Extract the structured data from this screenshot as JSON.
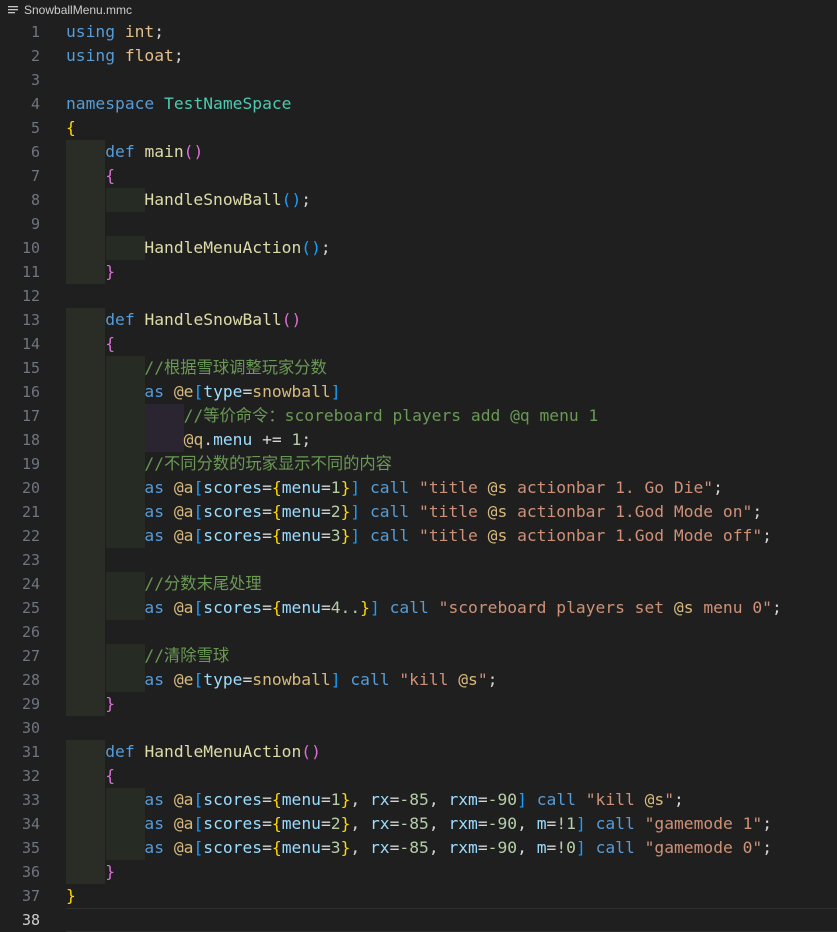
{
  "tab": {
    "filename": "SnowballMenu.mmc",
    "icon": "lines-file-icon"
  },
  "colors": {
    "background": "#1f1f1f",
    "keyword": "#569cd6",
    "function": "#dcdcaa",
    "comment": "#6a9955",
    "string": "#ce9178",
    "line_number": "#6e7681"
  },
  "lines": [
    {
      "n": "1",
      "guides": [],
      "tokens": [
        [
          "kw",
          "using"
        ],
        [
          "op",
          " "
        ],
        [
          "ty",
          "int"
        ],
        [
          "op",
          ";"
        ]
      ]
    },
    {
      "n": "2",
      "guides": [],
      "tokens": [
        [
          "kw",
          "using"
        ],
        [
          "op",
          " "
        ],
        [
          "ty",
          "float"
        ],
        [
          "op",
          ";"
        ]
      ]
    },
    {
      "n": "3",
      "guides": [],
      "tokens": []
    },
    {
      "n": "4",
      "guides": [],
      "tokens": [
        [
          "kw",
          "namespace"
        ],
        [
          "op",
          " "
        ],
        [
          "ns",
          "TestNameSpace"
        ]
      ]
    },
    {
      "n": "5",
      "guides": [],
      "tokens": [
        [
          "br1",
          "{"
        ]
      ]
    },
    {
      "n": "6",
      "guides": [
        1
      ],
      "tokens": [
        [
          "op",
          "    "
        ],
        [
          "kw",
          "def"
        ],
        [
          "op",
          " "
        ],
        [
          "fn",
          "main"
        ],
        [
          "br2",
          "()"
        ]
      ]
    },
    {
      "n": "7",
      "guides": [
        1
      ],
      "tokens": [
        [
          "op",
          "    "
        ],
        [
          "br2",
          "{"
        ]
      ]
    },
    {
      "n": "8",
      "guides": [
        1,
        2
      ],
      "tokens": [
        [
          "op",
          "        "
        ],
        [
          "fn",
          "HandleSnowBall"
        ],
        [
          "br3",
          "()"
        ],
        [
          "op",
          ";"
        ]
      ]
    },
    {
      "n": "9",
      "guides": [
        1
      ],
      "tokens": []
    },
    {
      "n": "10",
      "guides": [
        1,
        2
      ],
      "tokens": [
        [
          "op",
          "        "
        ],
        [
          "fn",
          "HandleMenuAction"
        ],
        [
          "br3",
          "()"
        ],
        [
          "op",
          ";"
        ]
      ]
    },
    {
      "n": "11",
      "guides": [
        1
      ],
      "tokens": [
        [
          "op",
          "    "
        ],
        [
          "br2",
          "}"
        ]
      ]
    },
    {
      "n": "12",
      "guides": [],
      "tokens": []
    },
    {
      "n": "13",
      "guides": [
        1
      ],
      "tokens": [
        [
          "op",
          "    "
        ],
        [
          "kw",
          "def"
        ],
        [
          "op",
          " "
        ],
        [
          "fn",
          "HandleSnowBall"
        ],
        [
          "br2",
          "()"
        ]
      ]
    },
    {
      "n": "14",
      "guides": [
        1
      ],
      "tokens": [
        [
          "op",
          "    "
        ],
        [
          "br2",
          "{"
        ]
      ]
    },
    {
      "n": "15",
      "guides": [
        1,
        2
      ],
      "tokens": [
        [
          "op",
          "        "
        ],
        [
          "cm",
          "//根据雪球调整玩家分数"
        ]
      ]
    },
    {
      "n": "16",
      "guides": [
        1,
        2
      ],
      "tokens": [
        [
          "op",
          "        "
        ],
        [
          "kw",
          "as"
        ],
        [
          "op",
          " "
        ],
        [
          "sel",
          "@e"
        ],
        [
          "br3",
          "["
        ],
        [
          "key",
          "type"
        ],
        [
          "op",
          "="
        ],
        [
          "sel",
          "snowball"
        ],
        [
          "br3",
          "]"
        ]
      ]
    },
    {
      "n": "17",
      "guides": [
        1,
        2,
        3
      ],
      "tokens": [
        [
          "op",
          "            "
        ],
        [
          "cm",
          "//等价命令：scoreboard players add @q menu 1"
        ]
      ]
    },
    {
      "n": "18",
      "guides": [
        1,
        2,
        3
      ],
      "tokens": [
        [
          "op",
          "            "
        ],
        [
          "sel",
          "@q"
        ],
        [
          "op",
          "."
        ],
        [
          "obj",
          "menu"
        ],
        [
          "op",
          " += "
        ],
        [
          "num",
          "1"
        ],
        [
          "op",
          ";"
        ]
      ]
    },
    {
      "n": "19",
      "guides": [
        1,
        2
      ],
      "tokens": [
        [
          "op",
          "        "
        ],
        [
          "cm",
          "//不同分数的玩家显示不同的内容"
        ]
      ]
    },
    {
      "n": "20",
      "guides": [
        1,
        2
      ],
      "tokens": [
        [
          "op",
          "        "
        ],
        [
          "kw",
          "as"
        ],
        [
          "op",
          " "
        ],
        [
          "sel",
          "@a"
        ],
        [
          "br3",
          "["
        ],
        [
          "key",
          "scores"
        ],
        [
          "op",
          "="
        ],
        [
          "br1",
          "{"
        ],
        [
          "key",
          "menu"
        ],
        [
          "op",
          "="
        ],
        [
          "num",
          "1"
        ],
        [
          "br1",
          "}"
        ],
        [
          "br3",
          "]"
        ],
        [
          "op",
          " "
        ],
        [
          "kw",
          "call"
        ],
        [
          "op",
          " "
        ],
        [
          "str",
          "\"title "
        ],
        [
          "sel",
          "@s"
        ],
        [
          "str",
          " actionbar 1. Go Die\""
        ],
        [
          "op",
          ";"
        ]
      ]
    },
    {
      "n": "21",
      "guides": [
        1,
        2
      ],
      "tokens": [
        [
          "op",
          "        "
        ],
        [
          "kw",
          "as"
        ],
        [
          "op",
          " "
        ],
        [
          "sel",
          "@a"
        ],
        [
          "br3",
          "["
        ],
        [
          "key",
          "scores"
        ],
        [
          "op",
          "="
        ],
        [
          "br1",
          "{"
        ],
        [
          "key",
          "menu"
        ],
        [
          "op",
          "="
        ],
        [
          "num",
          "2"
        ],
        [
          "br1",
          "}"
        ],
        [
          "br3",
          "]"
        ],
        [
          "op",
          " "
        ],
        [
          "kw",
          "call"
        ],
        [
          "op",
          " "
        ],
        [
          "str",
          "\"title "
        ],
        [
          "sel",
          "@s"
        ],
        [
          "str",
          " actionbar 1.God Mode on\""
        ],
        [
          "op",
          ";"
        ]
      ]
    },
    {
      "n": "22",
      "guides": [
        1,
        2
      ],
      "tokens": [
        [
          "op",
          "        "
        ],
        [
          "kw",
          "as"
        ],
        [
          "op",
          " "
        ],
        [
          "sel",
          "@a"
        ],
        [
          "br3",
          "["
        ],
        [
          "key",
          "scores"
        ],
        [
          "op",
          "="
        ],
        [
          "br1",
          "{"
        ],
        [
          "key",
          "menu"
        ],
        [
          "op",
          "="
        ],
        [
          "num",
          "3"
        ],
        [
          "br1",
          "}"
        ],
        [
          "br3",
          "]"
        ],
        [
          "op",
          " "
        ],
        [
          "kw",
          "call"
        ],
        [
          "op",
          " "
        ],
        [
          "str",
          "\"title "
        ],
        [
          "sel",
          "@s"
        ],
        [
          "str",
          " actionbar 1.God Mode off\""
        ],
        [
          "op",
          ";"
        ]
      ]
    },
    {
      "n": "23",
      "guides": [
        1
      ],
      "tokens": []
    },
    {
      "n": "24",
      "guides": [
        1,
        2
      ],
      "tokens": [
        [
          "op",
          "        "
        ],
        [
          "cm",
          "//分数末尾处理"
        ]
      ]
    },
    {
      "n": "25",
      "guides": [
        1,
        2
      ],
      "tokens": [
        [
          "op",
          "        "
        ],
        [
          "kw",
          "as"
        ],
        [
          "op",
          " "
        ],
        [
          "sel",
          "@a"
        ],
        [
          "br3",
          "["
        ],
        [
          "key",
          "scores"
        ],
        [
          "op",
          "="
        ],
        [
          "br1",
          "{"
        ],
        [
          "key",
          "menu"
        ],
        [
          "op",
          "="
        ],
        [
          "num",
          "4.."
        ],
        [
          "br1",
          "}"
        ],
        [
          "br3",
          "]"
        ],
        [
          "op",
          " "
        ],
        [
          "kw",
          "call"
        ],
        [
          "op",
          " "
        ],
        [
          "str",
          "\"scoreboard players set "
        ],
        [
          "sel",
          "@s"
        ],
        [
          "str",
          " menu 0\""
        ],
        [
          "op",
          ";"
        ]
      ]
    },
    {
      "n": "26",
      "guides": [
        1
      ],
      "tokens": []
    },
    {
      "n": "27",
      "guides": [
        1,
        2
      ],
      "tokens": [
        [
          "op",
          "        "
        ],
        [
          "cm",
          "//清除雪球"
        ]
      ]
    },
    {
      "n": "28",
      "guides": [
        1,
        2
      ],
      "tokens": [
        [
          "op",
          "        "
        ],
        [
          "kw",
          "as"
        ],
        [
          "op",
          " "
        ],
        [
          "sel",
          "@e"
        ],
        [
          "br3",
          "["
        ],
        [
          "key",
          "type"
        ],
        [
          "op",
          "="
        ],
        [
          "sel",
          "snowball"
        ],
        [
          "br3",
          "]"
        ],
        [
          "op",
          " "
        ],
        [
          "kw",
          "call"
        ],
        [
          "op",
          " "
        ],
        [
          "str",
          "\"kill "
        ],
        [
          "sel",
          "@s"
        ],
        [
          "str",
          "\""
        ],
        [
          "op",
          ";"
        ]
      ]
    },
    {
      "n": "29",
      "guides": [
        1
      ],
      "tokens": [
        [
          "op",
          "    "
        ],
        [
          "br2",
          "}"
        ]
      ]
    },
    {
      "n": "30",
      "guides": [],
      "tokens": []
    },
    {
      "n": "31",
      "guides": [
        1
      ],
      "tokens": [
        [
          "op",
          "    "
        ],
        [
          "kw",
          "def"
        ],
        [
          "op",
          " "
        ],
        [
          "fn",
          "HandleMenuAction"
        ],
        [
          "br2",
          "()"
        ]
      ]
    },
    {
      "n": "32",
      "guides": [
        1
      ],
      "tokens": [
        [
          "op",
          "    "
        ],
        [
          "br2",
          "{"
        ]
      ]
    },
    {
      "n": "33",
      "guides": [
        1,
        2
      ],
      "tokens": [
        [
          "op",
          "        "
        ],
        [
          "kw",
          "as"
        ],
        [
          "op",
          " "
        ],
        [
          "sel",
          "@a"
        ],
        [
          "br3",
          "["
        ],
        [
          "key",
          "scores"
        ],
        [
          "op",
          "="
        ],
        [
          "br1",
          "{"
        ],
        [
          "key",
          "menu"
        ],
        [
          "op",
          "="
        ],
        [
          "num",
          "1"
        ],
        [
          "br1",
          "}"
        ],
        [
          "op",
          ", "
        ],
        [
          "key",
          "rx"
        ],
        [
          "op",
          "="
        ],
        [
          "num",
          "-85"
        ],
        [
          "op",
          ", "
        ],
        [
          "key",
          "rxm"
        ],
        [
          "op",
          "="
        ],
        [
          "num",
          "-90"
        ],
        [
          "br3",
          "]"
        ],
        [
          "op",
          " "
        ],
        [
          "kw",
          "call"
        ],
        [
          "op",
          " "
        ],
        [
          "str",
          "\"kill "
        ],
        [
          "sel",
          "@s"
        ],
        [
          "str",
          "\""
        ],
        [
          "op",
          ";"
        ]
      ]
    },
    {
      "n": "34",
      "guides": [
        1,
        2
      ],
      "tokens": [
        [
          "op",
          "        "
        ],
        [
          "kw",
          "as"
        ],
        [
          "op",
          " "
        ],
        [
          "sel",
          "@a"
        ],
        [
          "br3",
          "["
        ],
        [
          "key",
          "scores"
        ],
        [
          "op",
          "="
        ],
        [
          "br1",
          "{"
        ],
        [
          "key",
          "menu"
        ],
        [
          "op",
          "="
        ],
        [
          "num",
          "2"
        ],
        [
          "br1",
          "}"
        ],
        [
          "op",
          ", "
        ],
        [
          "key",
          "rx"
        ],
        [
          "op",
          "="
        ],
        [
          "num",
          "-85"
        ],
        [
          "op",
          ", "
        ],
        [
          "key",
          "rxm"
        ],
        [
          "op",
          "="
        ],
        [
          "num",
          "-90"
        ],
        [
          "op",
          ", "
        ],
        [
          "key",
          "m"
        ],
        [
          "op",
          "="
        ],
        [
          "num",
          "!1"
        ],
        [
          "br3",
          "]"
        ],
        [
          "op",
          " "
        ],
        [
          "kw",
          "call"
        ],
        [
          "op",
          " "
        ],
        [
          "str",
          "\"gamemode 1\""
        ],
        [
          "op",
          ";"
        ]
      ]
    },
    {
      "n": "35",
      "guides": [
        1,
        2
      ],
      "tokens": [
        [
          "op",
          "        "
        ],
        [
          "kw",
          "as"
        ],
        [
          "op",
          " "
        ],
        [
          "sel",
          "@a"
        ],
        [
          "br3",
          "["
        ],
        [
          "key",
          "scores"
        ],
        [
          "op",
          "="
        ],
        [
          "br1",
          "{"
        ],
        [
          "key",
          "menu"
        ],
        [
          "op",
          "="
        ],
        [
          "num",
          "3"
        ],
        [
          "br1",
          "}"
        ],
        [
          "op",
          ", "
        ],
        [
          "key",
          "rx"
        ],
        [
          "op",
          "="
        ],
        [
          "num",
          "-85"
        ],
        [
          "op",
          ", "
        ],
        [
          "key",
          "rxm"
        ],
        [
          "op",
          "="
        ],
        [
          "num",
          "-90"
        ],
        [
          "op",
          ", "
        ],
        [
          "key",
          "m"
        ],
        [
          "op",
          "="
        ],
        [
          "num",
          "!0"
        ],
        [
          "br3",
          "]"
        ],
        [
          "op",
          " "
        ],
        [
          "kw",
          "call"
        ],
        [
          "op",
          " "
        ],
        [
          "str",
          "\"gamemode 0\""
        ],
        [
          "op",
          ";"
        ]
      ]
    },
    {
      "n": "36",
      "guides": [
        1
      ],
      "tokens": [
        [
          "op",
          "    "
        ],
        [
          "br2",
          "}"
        ]
      ]
    },
    {
      "n": "37",
      "guides": [],
      "tokens": [
        [
          "br1",
          "}"
        ]
      ]
    },
    {
      "n": "38",
      "guides": [],
      "tokens": [],
      "current": true
    }
  ]
}
